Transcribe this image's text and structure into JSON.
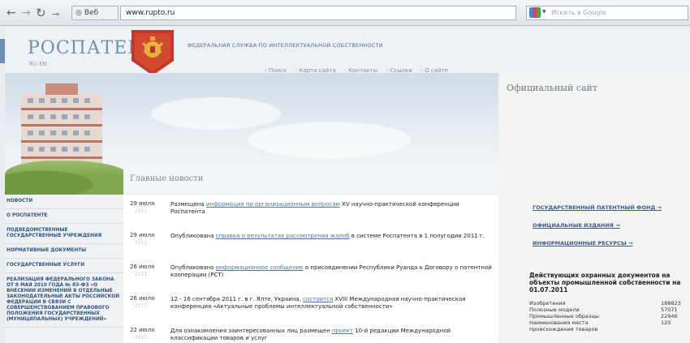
{
  "browser": {
    "nav": {
      "back": "←",
      "forward": "→",
      "reload": "↻",
      "stop": "⊸"
    },
    "site_label": "Веб",
    "url": "www.rupto.ru",
    "search_placeholder": "Искать в Google"
  },
  "header": {
    "logo": "РОСПАТЕНТ",
    "logo_sub": "RU  EN",
    "agency": "ФЕДЕРАЛЬНАЯ СЛУЖБА ПО ИНТЕЛЛЕКТУАЛЬНОЙ СОБСТВЕННОСТИ",
    "top_links": [
      "Поиск",
      "Карта сайта",
      "Контакты",
      "Ссылки",
      "О сайте"
    ]
  },
  "right_panel": {
    "title": "Официальный сайт",
    "links": [
      "ГОСУДАРСТВЕННЫЙ ПАТЕНТНЫЙ ФОНД →",
      "ОФИЦИАЛЬНЫЕ ИЗДАНИЯ →",
      "ИНФОРМАЦИОННЫЕ РЕСУРСЫ →"
    ],
    "stats": {
      "title": "Действующих охранных документов на объекты промышленной собственности на 01.07.2011",
      "rows": [
        {
          "label": "Изобретения",
          "value": "188823"
        },
        {
          "label": "Полезные модели",
          "value": "57071"
        },
        {
          "label": "Промышленные образцы",
          "value": "22946"
        },
        {
          "label": "Наименования места происхождения товаров",
          "value": "120"
        }
      ]
    }
  },
  "left_nav": [
    "НОВОСТИ",
    "О РОСПАТЕНТЕ",
    "ПОДВЕДОМСТВЕННЫЕ ГОСУДАРСТВЕННЫЕ УЧРЕЖДЕНИЯ",
    "НОРМАТИВНЫЕ ДОКУМЕНТЫ",
    "ГОСУДАРСТВЕННЫЕ УСЛУГИ",
    "РЕАЛИЗАЦИЯ ФЕДЕРАЛЬНОГО ЗАКОНА ОТ 8 МАЯ 2010 ГОДА № 83-ФЗ «О ВНЕСЕНИИ ИЗМЕНЕНИЙ В ОТДЕЛЬНЫЕ ЗАКОНОДАТЕЛЬНЫЕ АКТЫ РОССИЙСКОЙ ФЕДЕРАЦИИ В СВЯЗИ С СОВЕРШЕНСТВОВАНИЕМ ПРАВОВОГО ПОЛОЖЕНИЯ ГОСУДАРСТВЕННЫХ (МУНИЦИПАЛЬНЫХ) УЧРЕЖДЕНИЙ»"
  ],
  "news": {
    "title": "Главные новости",
    "items": [
      {
        "date": "29 июля",
        "year": "2011",
        "before": "Размещена ",
        "link": "информация по организационным вопросам",
        "after": " XV научно-практической конференции Роспатента"
      },
      {
        "date": "29 июля",
        "year": "2011",
        "before": "Опубликована ",
        "link": "справка о результатах рассмотрения жалоб",
        "after": " в системе Роспатента в 1 полугодии 2011 г."
      },
      {
        "date": "26 июля",
        "year": "2011",
        "before": "Опубликовано ",
        "link": "информационное сообщение",
        "after": " о присоединении Республики Руанда к Договору о патентной кооперации (PCT)"
      },
      {
        "date": "26 июля",
        "year": "2011",
        "before": "12 - 16 сентября 2011 г. в г. Ялте, Украина, ",
        "link": "состоится",
        "after": " XVIII Международная научно-практическая конференция «Актуальные проблемы интеллектуальной собственности»"
      },
      {
        "date": "22 июля",
        "year": "2011",
        "before": "Для ознакомления заинтересованных лиц размещен ",
        "link": "проект",
        "after": " 10-й редакции Международной классификации товаров и услуг"
      }
    ]
  }
}
